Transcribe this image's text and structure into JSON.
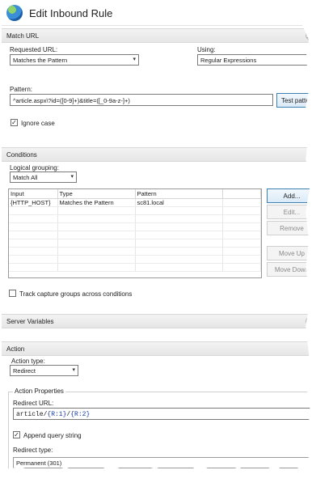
{
  "header": {
    "title": "Edit Inbound Rule"
  },
  "match_url": {
    "section_title": "Match URL",
    "requested_url_label": "Requested URL:",
    "requested_url_value": "Matches the Pattern",
    "using_label": "Using:",
    "using_value": "Regular Expressions",
    "pattern_label": "Pattern:",
    "pattern_value": "^article.aspx\\?id=([0-9]+)&title=([_0-9a-z-]+)",
    "test_pattern_button": "Test pattern...",
    "ignore_case_label": "Ignore case",
    "ignore_case_checked": true
  },
  "conditions": {
    "section_title": "Conditions",
    "logical_grouping_label": "Logical grouping:",
    "logical_grouping_value": "Match All",
    "columns": [
      "Input",
      "Type",
      "Pattern"
    ],
    "rows": [
      {
        "input": "{HTTP_HOST}",
        "type": "Matches the Pattern",
        "pattern": "sc81.local"
      }
    ],
    "buttons": {
      "add": "Add...",
      "edit": "Edit...",
      "remove": "Remove",
      "move_up": "Move Up",
      "move_down": "Move Down"
    },
    "track_capture_label": "Track capture groups across conditions",
    "track_capture_checked": false
  },
  "server_variables": {
    "section_title": "Server Variables"
  },
  "action": {
    "section_title": "Action",
    "action_type_label": "Action type:",
    "action_type_value": "Redirect",
    "properties_title": "Action Properties",
    "redirect_url_label": "Redirect URL:",
    "redirect_url_prefix": "article/",
    "redirect_url_r1": "{R:1}",
    "redirect_url_sep": "/",
    "redirect_url_r2": "{R:2}",
    "append_query_label": "Append query string",
    "append_query_checked": true,
    "redirect_type_label": "Redirect type:",
    "redirect_type_value": "Permanent (301)"
  },
  "colors": {
    "accent": "#3c7fb1",
    "r_token": "#1a3fa8"
  }
}
